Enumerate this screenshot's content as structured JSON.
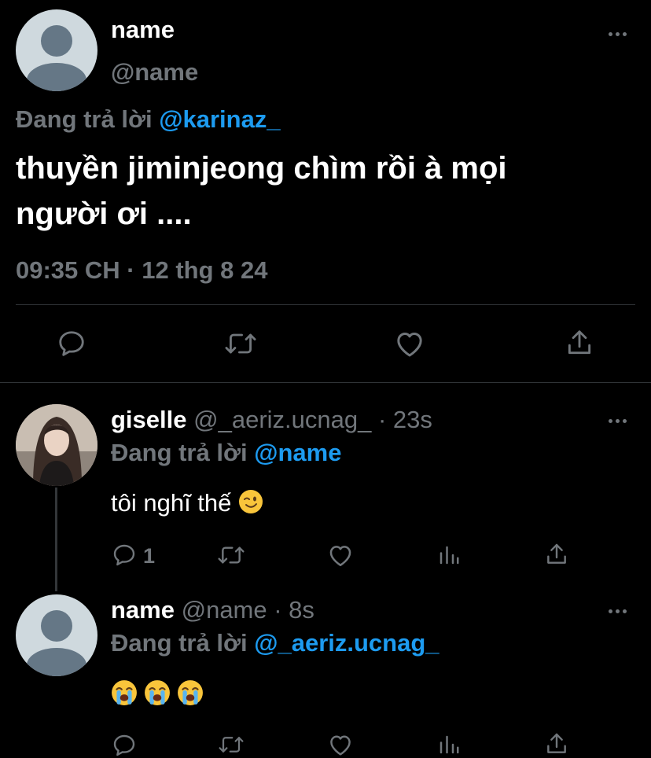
{
  "main_tweet": {
    "display_name": "name",
    "handle": "@name",
    "reply_prefix": "Đang trả lời",
    "reply_to": "@karinaz_",
    "text_line1": "thuyền jiminjeong chìm rồi à mọi",
    "text_line2": "người ơi ....",
    "timestamp": "09:35 CH · 12 thg 8 24",
    "actions": {
      "reply_icon": "reply-icon",
      "retweet_icon": "retweet-icon",
      "like_icon": "heart-icon",
      "share_icon": "share-icon"
    }
  },
  "reply1": {
    "display_name": "giselle",
    "handle": "@_aeriz.ucnag_",
    "time": "· 23s",
    "reply_prefix": "Đang trả lời",
    "reply_to": "@name",
    "text": "tôi nghĩ thế",
    "emoji": "winking-face",
    "reply_count": "1"
  },
  "reply2": {
    "display_name": "name",
    "handle": "@name",
    "time": "· 8s",
    "reply_prefix": "Đang trả lời",
    "reply_to": "@_aeriz.ucnag_",
    "emojis": [
      "loudly-crying-face",
      "loudly-crying-face",
      "loudly-crying-face"
    ]
  },
  "colors": {
    "background": "#000000",
    "text": "#ffffff",
    "muted": "#71767b",
    "link": "#1d9bf0",
    "divider": "#2f3336"
  }
}
